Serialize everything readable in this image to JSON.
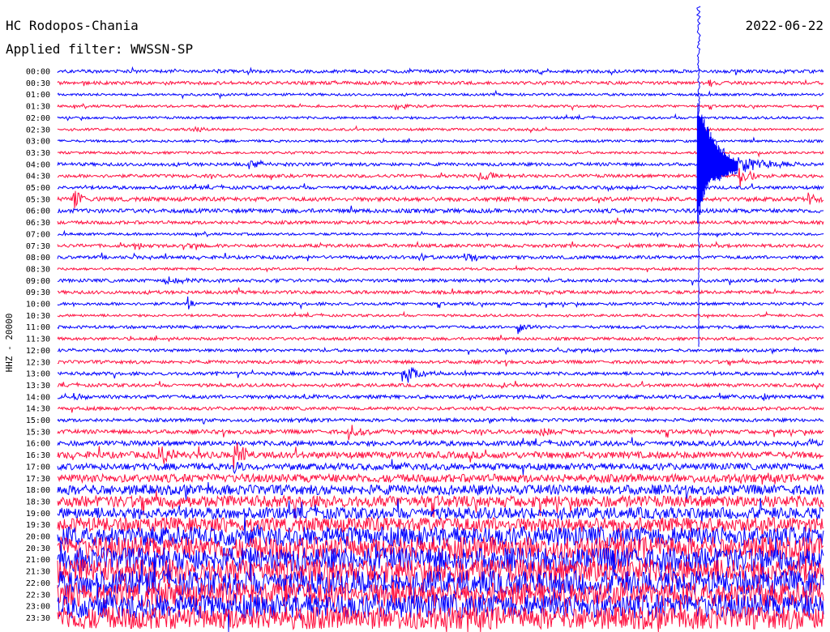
{
  "header": {
    "station": "HC Rodopos-Chania",
    "date": "2022-06-22",
    "filter": "Applied filter: WWSSN-SP"
  },
  "colors": {
    "even_trace": "#0000ff",
    "odd_trace": "#ff1040",
    "text": "#000000",
    "background": "#ffffff"
  },
  "chart_data": {
    "type": "line",
    "title": "",
    "ylabel": "HHZ - 20000",
    "xlabel": "",
    "grid": false,
    "legend": "none",
    "rows": [
      {
        "label": "00:00",
        "noise": 2.0
      },
      {
        "label": "00:30",
        "noise": 2.0
      },
      {
        "label": "01:00",
        "noise": 1.5
      },
      {
        "label": "01:30",
        "noise": 1.5
      },
      {
        "label": "02:00",
        "noise": 1.5
      },
      {
        "label": "02:30",
        "noise": 1.5
      },
      {
        "label": "03:00",
        "noise": 1.5
      },
      {
        "label": "03:30",
        "noise": 1.5
      },
      {
        "label": "04:00",
        "noise": 2.0
      },
      {
        "label": "04:30",
        "noise": 2.0
      },
      {
        "label": "05:00",
        "noise": 2.0
      },
      {
        "label": "05:30",
        "noise": 2.5
      },
      {
        "label": "06:00",
        "noise": 2.5
      },
      {
        "label": "06:30",
        "noise": 2.0
      },
      {
        "label": "07:00",
        "noise": 1.5
      },
      {
        "label": "07:30",
        "noise": 2.0
      },
      {
        "label": "08:00",
        "noise": 2.0
      },
      {
        "label": "08:30",
        "noise": 1.5
      },
      {
        "label": "09:00",
        "noise": 2.0
      },
      {
        "label": "09:30",
        "noise": 2.0
      },
      {
        "label": "10:00",
        "noise": 1.8
      },
      {
        "label": "10:30",
        "noise": 1.5
      },
      {
        "label": "11:00",
        "noise": 1.8
      },
      {
        "label": "11:30",
        "noise": 1.8
      },
      {
        "label": "12:00",
        "noise": 1.8
      },
      {
        "label": "12:30",
        "noise": 2.0
      },
      {
        "label": "13:00",
        "noise": 2.0
      },
      {
        "label": "13:30",
        "noise": 2.0
      },
      {
        "label": "14:00",
        "noise": 2.2
      },
      {
        "label": "14:30",
        "noise": 2.0
      },
      {
        "label": "15:00",
        "noise": 2.0
      },
      {
        "label": "15:30",
        "noise": 2.5
      },
      {
        "label": "16:00",
        "noise": 3.0
      },
      {
        "label": "16:30",
        "noise": 4.0
      },
      {
        "label": "17:00",
        "noise": 4.0
      },
      {
        "label": "17:30",
        "noise": 5.0
      },
      {
        "label": "18:00",
        "noise": 6.0
      },
      {
        "label": "18:30",
        "noise": 7.0
      },
      {
        "label": "19:00",
        "noise": 7.0
      },
      {
        "label": "19:30",
        "noise": 9.0
      },
      {
        "label": "20:00",
        "noise": 12.0
      },
      {
        "label": "20:30",
        "noise": 14.0
      },
      {
        "label": "21:00",
        "noise": 15.0
      },
      {
        "label": "21:30",
        "noise": 15.0
      },
      {
        "label": "22:00",
        "noise": 15.0
      },
      {
        "label": "22:30",
        "noise": 15.0
      },
      {
        "label": "23:00",
        "noise": 15.0
      },
      {
        "label": "23:30",
        "noise": 14.0
      }
    ],
    "events": [
      {
        "row": 0,
        "pos": 0.63,
        "amp": 4,
        "width": 0.012
      },
      {
        "row": 1,
        "pos": 0.36,
        "amp": 4,
        "width": 0.004
      },
      {
        "row": 1,
        "pos": 0.85,
        "amp": 5,
        "width": 0.01
      },
      {
        "row": 3,
        "pos": 0.44,
        "amp": 6,
        "width": 0.015
      },
      {
        "row": 5,
        "pos": 0.17,
        "amp": 3,
        "width": 0.02
      },
      {
        "row": 8,
        "pos": 0.25,
        "amp": 7,
        "width": 0.015
      },
      {
        "row": 8,
        "pos": 0.84,
        "amp": 40,
        "width": 0.04
      },
      {
        "row": 9,
        "pos": 0.55,
        "amp": 7,
        "width": 0.02
      },
      {
        "row": 9,
        "pos": 0.89,
        "amp": 15,
        "width": 0.015
      },
      {
        "row": 10,
        "pos": 0.72,
        "amp": 4,
        "width": 0.02
      },
      {
        "row": 11,
        "pos": 0.02,
        "amp": 14,
        "width": 0.01
      },
      {
        "row": 11,
        "pos": 0.98,
        "amp": 10,
        "width": 0.01
      },
      {
        "row": 12,
        "pos": 0.58,
        "amp": 5,
        "width": 0.003
      },
      {
        "row": 13,
        "pos": 0.36,
        "amp": 4,
        "width": 0.003
      },
      {
        "row": 15,
        "pos": 0.1,
        "amp": 6,
        "width": 0.01
      },
      {
        "row": 15,
        "pos": 0.17,
        "amp": 6,
        "width": 0.01
      },
      {
        "row": 15,
        "pos": 0.73,
        "amp": 5,
        "width": 0.01
      },
      {
        "row": 16,
        "pos": 0.1,
        "amp": 6,
        "width": 0.005
      },
      {
        "row": 16,
        "pos": 0.47,
        "amp": 6,
        "width": 0.01
      },
      {
        "row": 16,
        "pos": 0.53,
        "amp": 6,
        "width": 0.025
      },
      {
        "row": 18,
        "pos": 0.14,
        "amp": 4,
        "width": 0.03
      },
      {
        "row": 19,
        "pos": 0.62,
        "amp": 4,
        "width": 0.015
      },
      {
        "row": 20,
        "pos": 0.17,
        "amp": 8,
        "width": 0.006
      },
      {
        "row": 22,
        "pos": 0.6,
        "amp": 10,
        "width": 0.012
      },
      {
        "row": 24,
        "pos": 0.65,
        "amp": 4,
        "width": 0.005
      },
      {
        "row": 26,
        "pos": 0.45,
        "amp": 25,
        "width": 0.015
      },
      {
        "row": 26,
        "pos": 0.2,
        "amp": 4,
        "width": 0.01
      },
      {
        "row": 27,
        "pos": 0.58,
        "amp": 6,
        "width": 0.005
      },
      {
        "row": 28,
        "pos": 0.02,
        "amp": 6,
        "width": 0.01
      },
      {
        "row": 28,
        "pos": 0.32,
        "amp": 6,
        "width": 0.008
      },
      {
        "row": 28,
        "pos": 0.92,
        "amp": 6,
        "width": 0.005
      },
      {
        "row": 30,
        "pos": 0.19,
        "amp": 4,
        "width": 0.005
      },
      {
        "row": 31,
        "pos": 0.38,
        "amp": 10,
        "width": 0.02
      },
      {
        "row": 31,
        "pos": 0.63,
        "amp": 6,
        "width": 0.01
      },
      {
        "row": 32,
        "pos": 0.98,
        "amp": 4,
        "width": 0.01
      },
      {
        "row": 33,
        "pos": 0.13,
        "amp": 18,
        "width": 0.012
      },
      {
        "row": 33,
        "pos": 0.23,
        "amp": 22,
        "width": 0.012
      },
      {
        "row": 34,
        "pos": 0.23,
        "amp": 10,
        "width": 0.01
      }
    ],
    "mainshock": {
      "row": 8,
      "pos": 0.835,
      "amp": 95,
      "width": 0.012
    }
  }
}
